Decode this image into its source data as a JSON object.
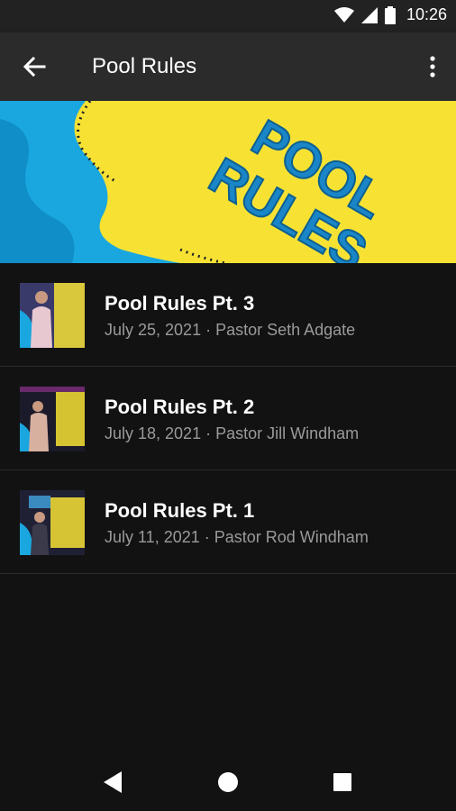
{
  "status_bar": {
    "time": "10:26"
  },
  "app_bar": {
    "title": "Pool Rules"
  },
  "banner": {
    "line1": "POOL",
    "line2": "RULES"
  },
  "thumb_text": "POOL RULES",
  "sermons": [
    {
      "title": "Pool Rules Pt. 3",
      "subtitle": "July 25, 2021 · Pastor Seth Adgate"
    },
    {
      "title": "Pool Rules Pt. 2",
      "subtitle": "July 18, 2021 · Pastor Jill Windham"
    },
    {
      "title": "Pool Rules Pt. 1",
      "subtitle": "July 11, 2021 · Pastor Rod Windham"
    }
  ],
  "colors": {
    "banner_yellow": "#f7e234",
    "banner_blue": "#1aa6df",
    "banner_text": "#1a86c7",
    "background": "#121213",
    "app_bar": "#2b2b2c"
  },
  "icons": [
    "wifi-icon",
    "signal-icon",
    "battery-icon",
    "back-arrow-icon",
    "more-vert-icon",
    "nav-back-icon",
    "nav-home-icon",
    "nav-recents-icon"
  ]
}
